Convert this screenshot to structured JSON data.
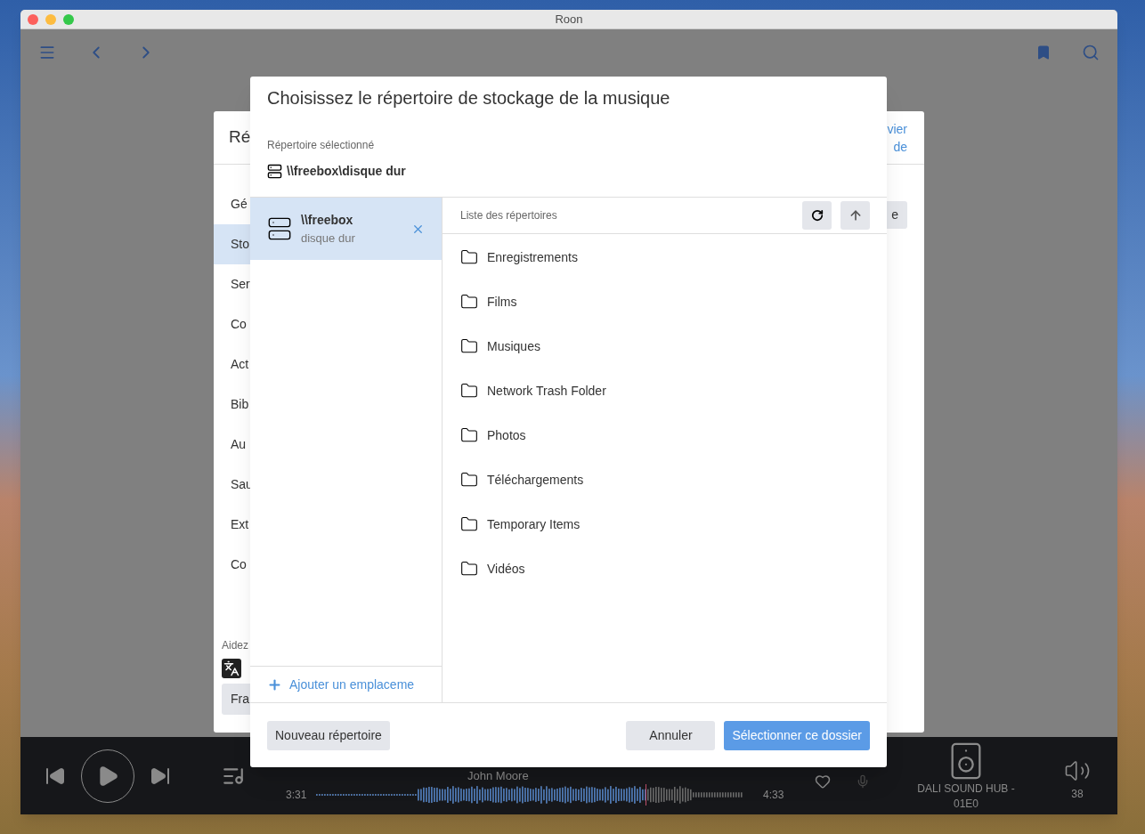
{
  "window": {
    "title": "Roon"
  },
  "settings_panel": {
    "title": "Ré",
    "link_lines": [
      "vier",
      "de"
    ],
    "side_button": "e",
    "items": [
      {
        "label": "Gé",
        "selected": false
      },
      {
        "label": "Sto",
        "selected": true
      },
      {
        "label": "Ser",
        "selected": false
      },
      {
        "label": "Co",
        "selected": false
      },
      {
        "label": "Act",
        "selected": false
      },
      {
        "label": "Bib",
        "selected": false
      },
      {
        "label": "Au",
        "selected": false
      },
      {
        "label": "Sau",
        "selected": false
      },
      {
        "label": "Ext",
        "selected": false
      },
      {
        "label": "Co",
        "selected": false
      }
    ],
    "help_text": "Aidez",
    "language_button": "Fra"
  },
  "dialog": {
    "title": "Choisissez le répertoire de stockage de la musique",
    "selected_label": "Répertoire sélectionné",
    "selected_path": "\\\\freebox\\disque dur",
    "locations": [
      {
        "name": "\\\\freebox",
        "sublabel": "disque dur",
        "selected": true
      }
    ],
    "add_location": "Ajouter un emplaceme",
    "list_header": "Liste des répertoires",
    "folders": [
      "Enregistrements",
      "Films",
      "Musiques",
      "Network Trash Folder",
      "Photos",
      "Téléchargements",
      "Temporary Items",
      "Vidéos"
    ],
    "buttons": {
      "new_folder": "Nouveau répertoire",
      "cancel": "Annuler",
      "confirm": "Sélectionner ce dossier"
    }
  },
  "player": {
    "artist": "John Moore",
    "elapsed": "3:31",
    "duration": "4:33",
    "level": 0.77,
    "zone": "DALI SOUND HUB - 01E0",
    "volume": "38"
  }
}
